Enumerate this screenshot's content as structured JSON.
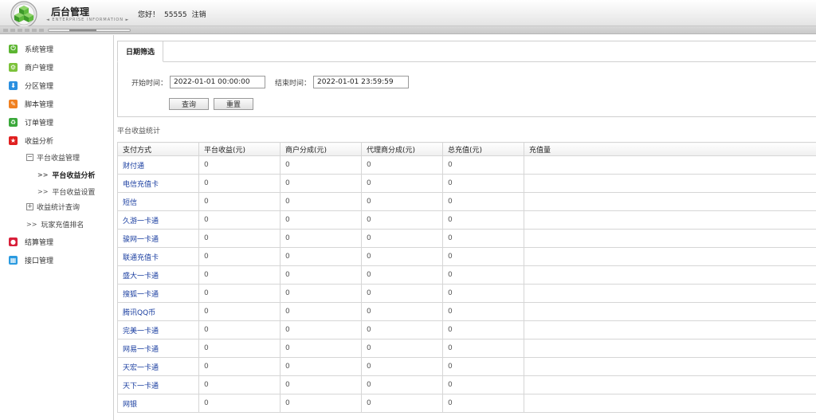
{
  "header": {
    "title": "后台管理",
    "subtitle": "◄ ENTERPRISE INFORMATION ►",
    "greeting": "您好！",
    "username": "55555",
    "logout": "注销"
  },
  "sidebar": {
    "items": [
      {
        "label": "系统管理",
        "icon": "power-icon",
        "color": "#5cb531"
      },
      {
        "label": "商户管理",
        "icon": "gear-icon",
        "color": "#7cc23a"
      },
      {
        "label": "分区管理",
        "icon": "download-icon",
        "color": "#2a8fe0"
      },
      {
        "label": "脚本管理",
        "icon": "pencil-icon",
        "color": "#f08020"
      },
      {
        "label": "订单管理",
        "icon": "recycle-icon",
        "color": "#3aa83a"
      },
      {
        "label": "收益分析",
        "icon": "star-icon",
        "color": "#e02020"
      },
      {
        "label": "结算管理",
        "icon": "record-icon",
        "color": "#d8203a"
      },
      {
        "label": "接口管理",
        "icon": "window-icon",
        "color": "#2a9ae0"
      }
    ],
    "sub": {
      "platform_mgmt": "平台收益管理",
      "platform_analysis": "平台收益分析",
      "platform_settings": "平台收益设置",
      "income_query": "收益统计查询",
      "player_rank": "玩家充值排名",
      "expanded_mark": "−",
      "collapsed_mark": "+",
      "arrow": ">>"
    }
  },
  "filter": {
    "tab": "日期筛选",
    "start_label": "开始时间：",
    "start_value": "2022-01-01 00:00:00",
    "end_label": "结束时间：",
    "end_value": "2022-01-01 23:59:59",
    "query": "查询",
    "reset": "重置"
  },
  "section_title": "平台收益统计",
  "table": {
    "headers": [
      "支付方式",
      "平台收益(元)",
      "商户分成(元)",
      "代理商分成(元)",
      "总充值(元)",
      "充值量"
    ],
    "rows": [
      [
        "财付通",
        "0",
        "0",
        "0",
        "0",
        ""
      ],
      [
        "电信充值卡",
        "0",
        "0",
        "0",
        "0",
        ""
      ],
      [
        "短信",
        "0",
        "0",
        "0",
        "0",
        ""
      ],
      [
        "久游一卡通",
        "0",
        "0",
        "0",
        "0",
        ""
      ],
      [
        "骏网一卡通",
        "0",
        "0",
        "0",
        "0",
        ""
      ],
      [
        "联通充值卡",
        "0",
        "0",
        "0",
        "0",
        ""
      ],
      [
        "盛大一卡通",
        "0",
        "0",
        "0",
        "0",
        ""
      ],
      [
        "搜狐一卡通",
        "0",
        "0",
        "0",
        "0",
        ""
      ],
      [
        "腾讯QQ币",
        "0",
        "0",
        "0",
        "0",
        ""
      ],
      [
        "完美一卡通",
        "0",
        "0",
        "0",
        "0",
        ""
      ],
      [
        "网易一卡通",
        "0",
        "0",
        "0",
        "0",
        ""
      ],
      [
        "天宏一卡通",
        "0",
        "0",
        "0",
        "0",
        ""
      ],
      [
        "天下一卡通",
        "0",
        "0",
        "0",
        "0",
        ""
      ],
      [
        "网银",
        "0",
        "0",
        "0",
        "0",
        ""
      ]
    ]
  }
}
